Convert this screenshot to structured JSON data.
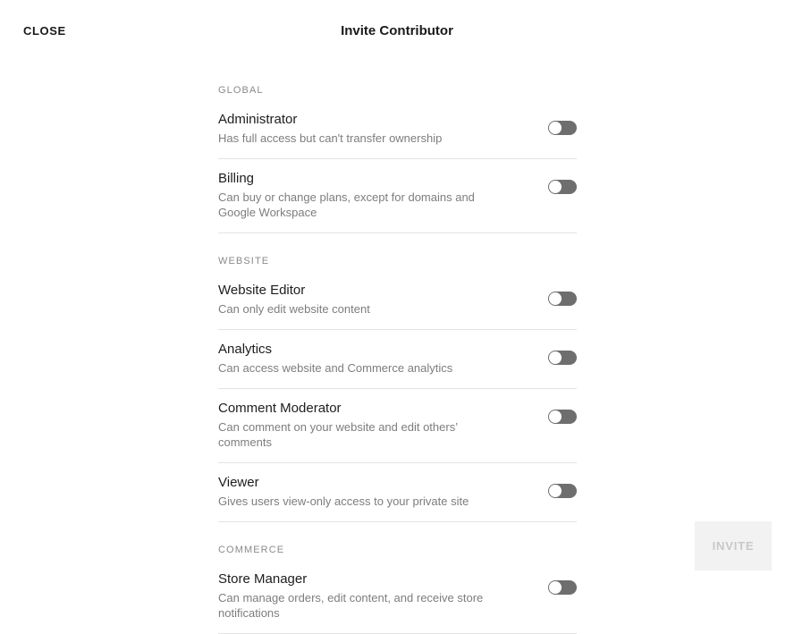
{
  "header": {
    "close_label": "CLOSE",
    "title": "Invite Contributor"
  },
  "colors": {
    "page_background": "#ffffff",
    "title_text": "#1a1a1a",
    "row_title_text": "#1d1d1d",
    "row_description_text": "#7d7d7d",
    "section_label_text": "#8a8a8a",
    "divider": "#e3e3e3",
    "toggle_off_track": "#6e6e6e",
    "toggle_knob": "#ffffff",
    "invite_button_background": "#f2f2f2",
    "invite_button_text": "#c8c8c8"
  },
  "sections": [
    {
      "label": "GLOBAL",
      "rows": [
        {
          "title": "Administrator",
          "description": "Has full access but can't transfer ownership",
          "toggle_state": "off"
        },
        {
          "title": "Billing",
          "description": "Can buy or change plans, except for domains and Google Workspace",
          "toggle_state": "off"
        }
      ]
    },
    {
      "label": "WEBSITE",
      "rows": [
        {
          "title": "Website Editor",
          "description": "Can only edit website content",
          "toggle_state": "off"
        },
        {
          "title": "Analytics",
          "description": "Can access website and Commerce analytics",
          "toggle_state": "off"
        },
        {
          "title": "Comment Moderator",
          "description": "Can comment on your website and edit others’ comments",
          "toggle_state": "off"
        },
        {
          "title": "Viewer",
          "description": "Gives users view-only access to your private site",
          "toggle_state": "off"
        }
      ]
    },
    {
      "label": "COMMERCE",
      "rows": [
        {
          "title": "Store Manager",
          "description": "Can manage orders, edit content, and receive store notifications",
          "toggle_state": "off"
        }
      ]
    }
  ],
  "footer": {
    "invite_label": "INVITE",
    "invite_disabled": true
  },
  "icons": {
    "toggle": "toggle-switch-icon"
  }
}
